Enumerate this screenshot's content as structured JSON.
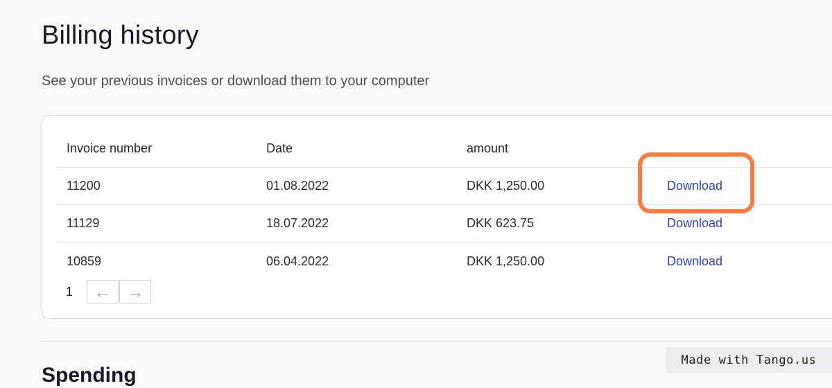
{
  "page": {
    "title": "Billing history",
    "subtitle": "See your previous invoices or download them to your computer"
  },
  "table": {
    "headers": [
      "Invoice number",
      "Date",
      "amount"
    ],
    "rows": [
      {
        "invoice": "11200",
        "date": "01.08.2022",
        "amount": "DKK 1,250.00",
        "action": "Download"
      },
      {
        "invoice": "11129",
        "date": "18.07.2022",
        "amount": "DKK 623.75",
        "action": "Download"
      },
      {
        "invoice": "10859",
        "date": "06.04.2022",
        "amount": "DKK 1,250.00",
        "action": "Download"
      }
    ]
  },
  "pagination": {
    "current_page": "1",
    "prev_icon": "arrow-left-icon",
    "next_icon": "arrow-right-icon",
    "prev_glyph": "←",
    "next_glyph": "→"
  },
  "next_section": {
    "title": "Spending"
  },
  "watermark": {
    "text": "Made with Tango.us"
  },
  "colors": {
    "background": "#f8f9fd",
    "link": "#2f3fd0",
    "highlight": "#ff7b3d",
    "card_border": "#d7dae3"
  }
}
